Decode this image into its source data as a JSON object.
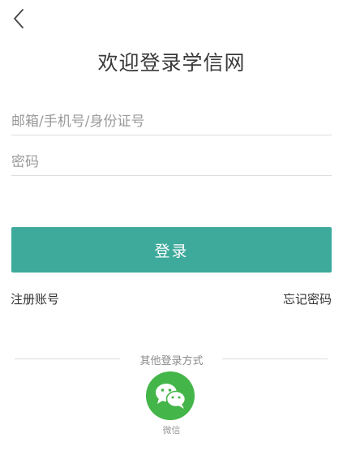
{
  "header": {
    "back_icon": "chevron-left-icon"
  },
  "page": {
    "title": "欢迎登录学信网"
  },
  "form": {
    "account_placeholder": "邮箱/手机号/身份证号",
    "password_placeholder": "密码",
    "login_label": "登录"
  },
  "links": {
    "register_label": "注册账号",
    "forgot_label": "忘记密码"
  },
  "other_login": {
    "label": "其他登录方式",
    "wechat_icon": "wechat-icon",
    "wechat_label": "微信"
  },
  "colors": {
    "accent": "#3daa9b",
    "wechat": "#44b549"
  }
}
